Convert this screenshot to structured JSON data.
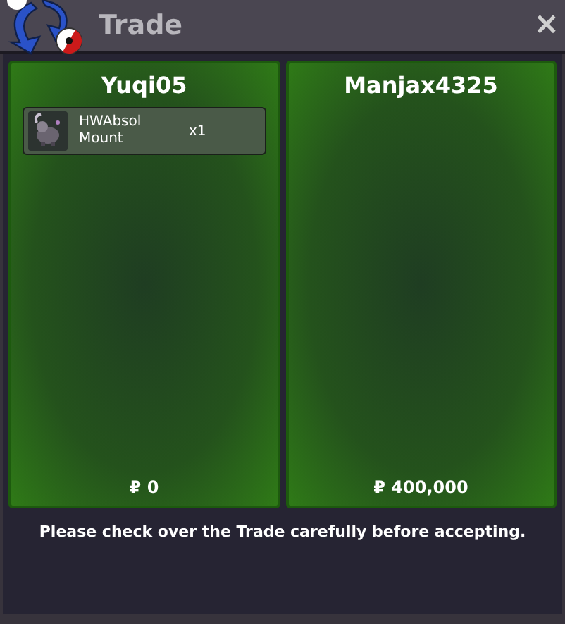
{
  "window": {
    "title": "Trade",
    "close": "×"
  },
  "panels": [
    {
      "player": "Yuqi05",
      "items": [
        {
          "kind": "picture",
          "name": "HWAbsol Mount",
          "quantity": "x1"
        }
      ],
      "money": "₽ 0"
    },
    {
      "player": "Manjax4325",
      "money": "₽ 400,000"
    }
  ],
  "notice": "Please check over the Trade carefully before accepting."
}
